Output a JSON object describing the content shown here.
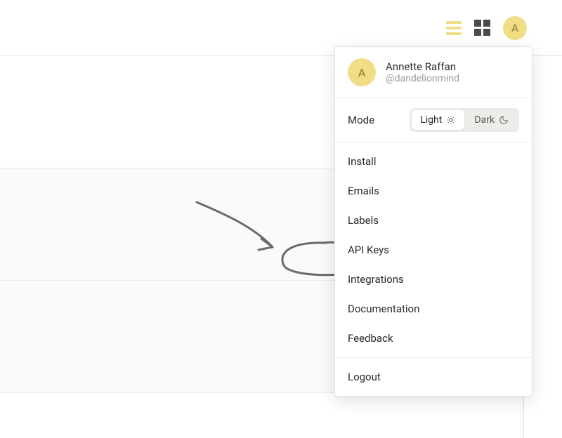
{
  "user": {
    "initial": "A",
    "name": "Annette Raffan",
    "handle": "@dandelionmind"
  },
  "mode": {
    "label": "Mode",
    "light": "Light",
    "dark": "Dark",
    "active": "light"
  },
  "menu": {
    "items": [
      {
        "label": "Install"
      },
      {
        "label": "Emails"
      },
      {
        "label": "Labels"
      },
      {
        "label": "API Keys"
      },
      {
        "label": "Integrations"
      },
      {
        "label": "Documentation"
      },
      {
        "label": "Feedback"
      }
    ],
    "logout": "Logout"
  }
}
